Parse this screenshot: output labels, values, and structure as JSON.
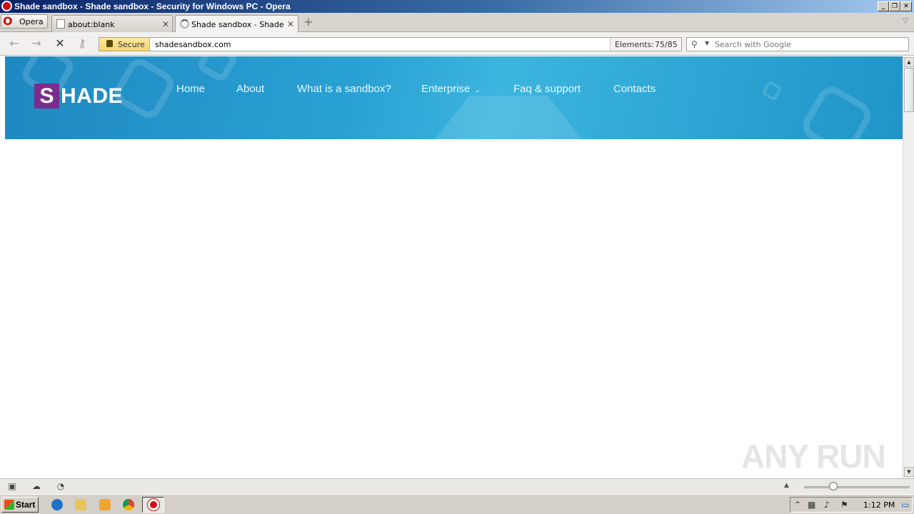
{
  "window": {
    "title": "Shade sandbox - Shade sandbox - Security for Windows PC - Opera",
    "controls": [
      "minimize",
      "restore",
      "close"
    ]
  },
  "browser": {
    "menu_label": "Opera",
    "tabs": [
      {
        "label": "about:blank",
        "active": false
      },
      {
        "label": "Shade sandbox - Shade ...",
        "active": true,
        "loading": true
      }
    ],
    "address": {
      "secure_label": "Secure",
      "url": "shadesandbox.com",
      "elements_label": "Elements:",
      "elements_value": "75/85"
    },
    "search": {
      "placeholder": "Search with Google"
    }
  },
  "page": {
    "logo": {
      "first_letter": "S",
      "rest": "HADE",
      "accent_color": "#7b2c8e"
    },
    "nav": [
      {
        "label": "Home"
      },
      {
        "label": "About"
      },
      {
        "label": "What is a sandbox?"
      },
      {
        "label": "Enterprise",
        "has_dropdown": true
      },
      {
        "label": "Faq & support"
      },
      {
        "label": "Contacts"
      }
    ],
    "banner_color": "#2aa2d4"
  },
  "watermark": "ANY RUN",
  "taskbar": {
    "start_label": "Start",
    "clock": "1:12 PM"
  }
}
